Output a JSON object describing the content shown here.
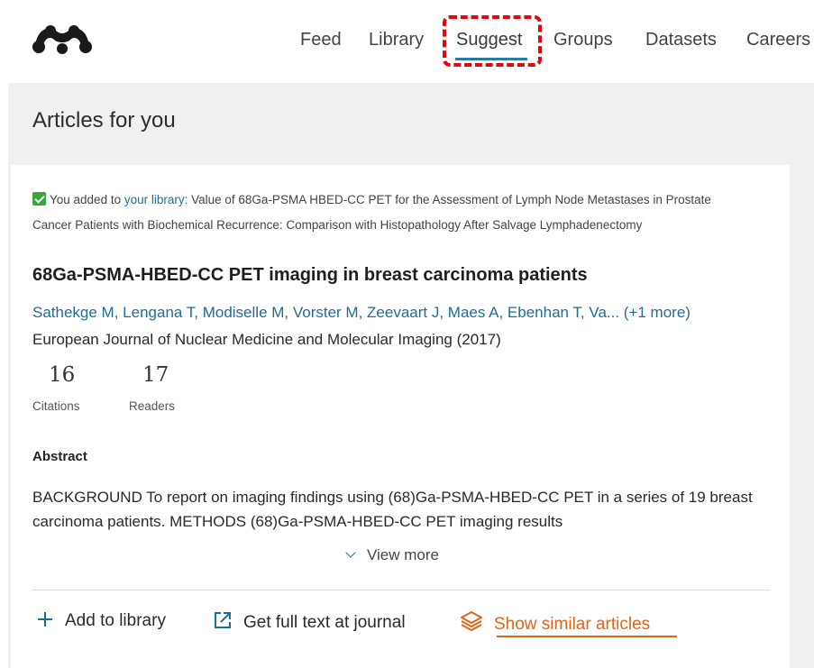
{
  "nav": {
    "items": [
      "Feed",
      "Library",
      "Suggest",
      "Groups",
      "Datasets",
      "Careers"
    ],
    "active": "Suggest"
  },
  "panel": {
    "title": "Articles for you"
  },
  "article": {
    "added_prefix": "You added to ",
    "added_link": "your library",
    "added_text": ": Value of 68Ga-PSMA HBED-CC PET for the Assessment of Lymph Node Metastases in Prostate Cancer Patients with Biochemical Recurrence: Comparison with Histopathology After Salvage Lymphadenectomy",
    "title": "68Ga-PSMA-HBED-CC PET imaging in breast carcinoma patients",
    "authors": "Sathekge M, Lengana T, Modiselle M, Vorster M, Zeevaart J, Maes A, Ebenhan T, Va... (+1 more)",
    "journal": "European Journal of Nuclear Medicine and Molecular Imaging (2017)",
    "citations": "16",
    "citations_label": "Citations",
    "readers": "17",
    "readers_label": "Readers",
    "abstract_heading": "Abstract",
    "abstract_text": "BACKGROUND To report on imaging findings using (68)Ga-PSMA-HBED-CC PET in a series of 19 breast carcinoma patients. METHODS (68)Ga-PSMA-HBED-CC PET imaging results",
    "view_more": "View more"
  },
  "actions": {
    "add_library": "Add to library",
    "full_text": "Get full text at journal",
    "similar": "Show similar articles"
  },
  "colors": {
    "accent": "#2a7ba0",
    "link": "#1f6d95",
    "orange": "#e0641a",
    "check": "#3aa53a",
    "highlight": "#e3060c"
  }
}
